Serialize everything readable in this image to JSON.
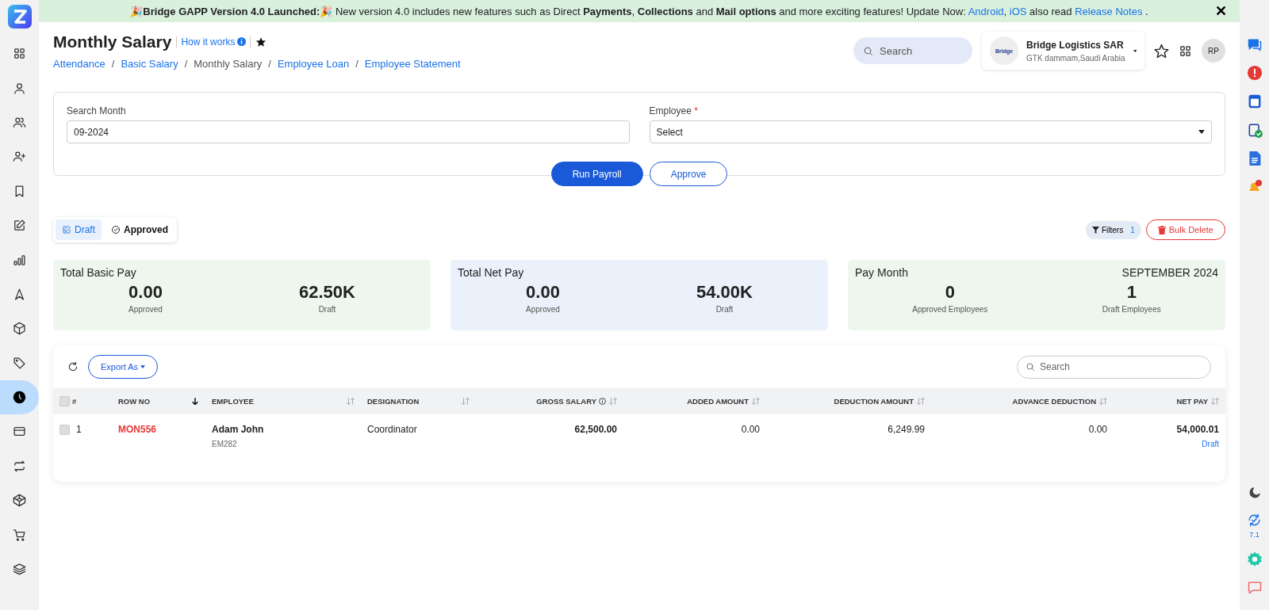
{
  "banner": {
    "segments": [
      {
        "kind": "text",
        "text": "🎉**Bridge GAPP Version 4.0 Launched:**🎉 New version 4.0 includes new features such as Direct **Payments**, **Collections** and **Mail options** and more exciting features! Update Now: "
      },
      {
        "kind": "link",
        "text": "Android"
      },
      {
        "kind": "text",
        "text": ", "
      },
      {
        "kind": "link",
        "text": "iOS"
      },
      {
        "kind": "text",
        "text": " also read "
      },
      {
        "kind": "link",
        "text": "Release Notes"
      },
      {
        "kind": "text",
        "text": " ."
      }
    ],
    "close": "✕"
  },
  "sidebar": {
    "items": [
      {
        "selected": false
      },
      {
        "selected": false
      },
      {
        "selected": false
      },
      {
        "selected": false
      },
      {
        "selected": false
      },
      {
        "selected": false
      },
      {
        "selected": false
      },
      {
        "selected": false
      },
      {
        "selected": false
      },
      {
        "selected": false
      },
      {
        "selected": true
      },
      {
        "selected": false
      },
      {
        "selected": false
      },
      {
        "selected": false
      },
      {
        "selected": false
      },
      {
        "selected": false
      }
    ]
  },
  "header": {
    "title": "Monthly Salary",
    "help_link": "How it works",
    "breadcrumb_separator": "/",
    "breadcrumbs": [
      {
        "label": "Attendance",
        "current": false
      },
      {
        "label": "Basic Salary",
        "current": false
      },
      {
        "label": "Monthly Salary",
        "current": true
      },
      {
        "label": "Employee Loan",
        "current": false
      },
      {
        "label": "Employee Statement",
        "current": false
      }
    ],
    "search": {
      "placeholder": "Search"
    },
    "company": {
      "logo_text": "Bridge",
      "name": "Bridge Logistics SAR",
      "location": "GTK dammam,Saudi Arabia"
    },
    "avatar": "RP"
  },
  "filter_form": {
    "fields": [
      {
        "label": "Search Month",
        "value": "09-2024",
        "kind": "input"
      },
      {
        "label": "Employee",
        "required_mark": "*",
        "value": "Select",
        "kind": "select"
      }
    ],
    "buttons": [
      {
        "label": "Run Payroll",
        "kind": "primary"
      },
      {
        "label": "Approve",
        "kind": "outline"
      }
    ]
  },
  "status_tabs": [
    {
      "label": "Draft",
      "selected": true
    },
    {
      "label": "Approved",
      "selected": false
    }
  ],
  "filters": {
    "label": "Filters",
    "count": "1"
  },
  "bulk_delete": "Bulk Delete",
  "summary_cards": [
    {
      "title": "Total Basic Pay",
      "color": "#edf7ee",
      "stats": [
        {
          "value": "0.00",
          "label": "Approved"
        },
        {
          "value": "62.50K",
          "label": "Draft"
        }
      ]
    },
    {
      "title": "Total Net Pay",
      "color": "#eaf1fa",
      "stats": [
        {
          "value": "0.00",
          "label": "Approved"
        },
        {
          "value": "54.00K",
          "label": "Draft"
        }
      ]
    },
    {
      "title": "Pay Month",
      "aside": "SEPTEMBER 2024",
      "color": "#edf7ee",
      "stats": [
        {
          "value": "0",
          "label": "Approved Employees"
        },
        {
          "value": "1",
          "label": "Draft Employees"
        }
      ]
    }
  ],
  "table": {
    "export_label": "Export As",
    "search": {
      "placeholder": "Search"
    },
    "columns": [
      {
        "label": "#",
        "sortable": false,
        "sorted": false,
        "info": false
      },
      {
        "label": "ROW NO",
        "sortable": true,
        "sorted": true,
        "info": false
      },
      {
        "label": "EMPLOYEE",
        "sortable": true,
        "sorted": false,
        "info": false
      },
      {
        "label": "DESIGNATION",
        "sortable": true,
        "sorted": false,
        "info": false
      },
      {
        "label": "GROSS SALARY",
        "sortable": true,
        "sorted": false,
        "info": true
      },
      {
        "label": "ADDED AMOUNT",
        "sortable": true,
        "sorted": false,
        "info": false
      },
      {
        "label": "DEDUCTION AMOUNT",
        "sortable": true,
        "sorted": false,
        "info": false
      },
      {
        "label": "ADVANCE DEDUCTION",
        "sortable": true,
        "sorted": false,
        "info": false
      },
      {
        "label": "NET PAY",
        "sortable": true,
        "sorted": false,
        "info": false
      }
    ],
    "rows": [
      {
        "checked": false,
        "index": "1",
        "row_no": "MON556",
        "employee": "Adam John",
        "employee_code": "EM282",
        "designation": "Coordinator",
        "gross_salary": "62,500.00",
        "added_amount": "0.00",
        "deduction_amount": "6,249.99",
        "advance_deduction": "0.00",
        "net_pay": "54,000.01",
        "status": "Draft"
      }
    ]
  },
  "right_rail": {
    "version": "7.1"
  }
}
